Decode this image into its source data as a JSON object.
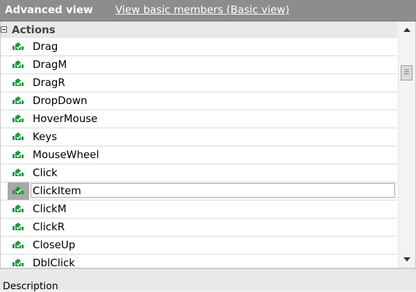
{
  "header": {
    "title": "Advanced view",
    "basic_link": "View basic members (Basic view)"
  },
  "group": {
    "label": "Actions",
    "expanded": true
  },
  "items": [
    {
      "label": "Drag",
      "icon": "action-icon"
    },
    {
      "label": "DragM",
      "icon": "action-icon"
    },
    {
      "label": "DragR",
      "icon": "action-icon"
    },
    {
      "label": "DropDown",
      "icon": "action-icon"
    },
    {
      "label": "HoverMouse",
      "icon": "action-icon"
    },
    {
      "label": "Keys",
      "icon": "action-icon"
    },
    {
      "label": "MouseWheel",
      "icon": "action-icon"
    },
    {
      "label": "Click",
      "icon": "action-icon"
    },
    {
      "label": "ClickItem",
      "icon": "action-icon",
      "selected": true
    },
    {
      "label": "ClickM",
      "icon": "action-icon"
    },
    {
      "label": "ClickR",
      "icon": "action-icon"
    },
    {
      "label": "CloseUp",
      "icon": "action-icon"
    },
    {
      "label": "DblClick",
      "icon": "action-icon"
    }
  ],
  "footer": {
    "description_label": "Description"
  },
  "colors": {
    "header_bg": "#8d8d8d",
    "icon_green": "#1e9a3a",
    "selected_gutter": "#a9a9a9"
  }
}
